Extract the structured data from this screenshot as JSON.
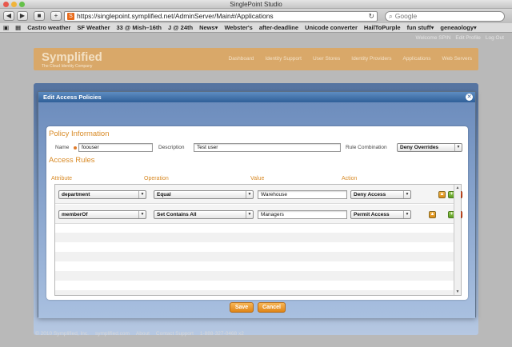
{
  "window": {
    "title": "SinglePoint Studio"
  },
  "browser": {
    "back": "◀",
    "forward": "▶",
    "stop": "■",
    "add": "+",
    "favicon": "S",
    "url": "https://singlepoint.symplified.net/AdminServer/Main#/Applications",
    "reload": "↻",
    "search_placeholder": "Google",
    "bookmarks": [
      "Castro weather",
      "SF Weather",
      "33 @ Mish–16th",
      "J @ 24th",
      "News▾",
      "Webster's",
      "after-deadline",
      "Unicode converter",
      "HailToPurple",
      "fun stuff▾",
      "geneaology▾"
    ]
  },
  "site": {
    "topnav": [
      "Welcome SPIN",
      "Edit Profile",
      "Log Out"
    ],
    "logo": "Symplified",
    "tagline": "The Cloud Identity Company",
    "menu": [
      "Dashboard",
      "Identity Support",
      "User Stores",
      "Identity Providers",
      "Applications",
      "Web Servers"
    ],
    "footer": [
      "© 2010 Symplified, Inc.",
      "symplified.com",
      "About",
      "Contact Support",
      "1-888-327-0468 x2"
    ]
  },
  "dialog": {
    "title": "Edit Access Policies",
    "close_icon": "close-icon",
    "policy_info_title": "Policy Information",
    "name_label": "Name",
    "name_value": "foouser",
    "description_label": "Description",
    "description_value": "Test user",
    "rule_combination_label": "Rule Combination",
    "rule_combination_value": "Deny Overrides",
    "access_rules_title": "Access Rules",
    "columns": [
      "Attribute",
      "Operation",
      "Value",
      "Action"
    ],
    "rules": [
      {
        "attribute": "department",
        "operation": "Equal",
        "value": "Warehouse",
        "action": "Deny Access",
        "first": true
      },
      {
        "attribute": "memberOf",
        "operation": "Set Contains All",
        "value": "Managers",
        "action": "Permit Access",
        "first": false
      }
    ],
    "save_label": "Save",
    "cancel_label": "Cancel"
  },
  "colors": {
    "accent": "#d88a26",
    "dialog_header": "#2f5f98"
  }
}
